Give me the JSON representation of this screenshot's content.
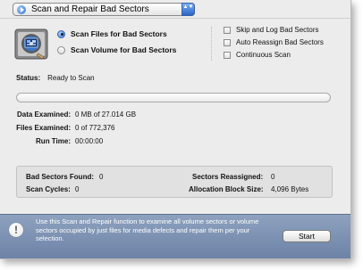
{
  "operation_popup": {
    "selected": "Scan and Repair Bad Sectors",
    "stepper_glyph": "▲▼",
    "accent": "#2f6fd0"
  },
  "icons": {
    "disk": "hard-disk-icon",
    "popup_bullet": "play-bullet-icon",
    "alert": "info-exclamation-icon"
  },
  "scan_mode": {
    "options": [
      {
        "label": "Scan Files for Bad Sectors",
        "selected": true
      },
      {
        "label": "Scan Volume for Bad Sectors",
        "selected": false
      }
    ]
  },
  "options": {
    "items": [
      {
        "label": "Skip and Log Bad Sectors",
        "checked": false
      },
      {
        "label": "Auto Reassign Bad Sectors",
        "checked": false
      },
      {
        "label": "Continuous Scan",
        "checked": false
      }
    ]
  },
  "status": {
    "label": "Status:",
    "value": "Ready to Scan"
  },
  "progress": {
    "percent": 0
  },
  "stats": {
    "data_examined": {
      "label": "Data Examined:",
      "value": "0 MB of 27.014 GB"
    },
    "files_examined": {
      "label": "Files Examined:",
      "value": "0 of 772,376"
    },
    "run_time": {
      "label": "Run Time:",
      "value": "00:00:00"
    }
  },
  "summary": {
    "bad_sectors_found": {
      "label": "Bad Sectors Found:",
      "value": "0"
    },
    "scan_cycles": {
      "label": "Scan Cycles:",
      "value": "0"
    },
    "sectors_reassigned": {
      "label": "Sectors Reassigned:",
      "value": "0"
    },
    "allocation_block_size": {
      "label": "Allocation Block Size:",
      "value": "4,096 Bytes"
    }
  },
  "footer": {
    "alert_glyph": "!",
    "message": "Use this Scan and Repair function to examine all volume sectors or volume sectors occupied by just files for media defects and repair them per your selection.",
    "start_label": "Start",
    "background": "#7d92b3"
  }
}
